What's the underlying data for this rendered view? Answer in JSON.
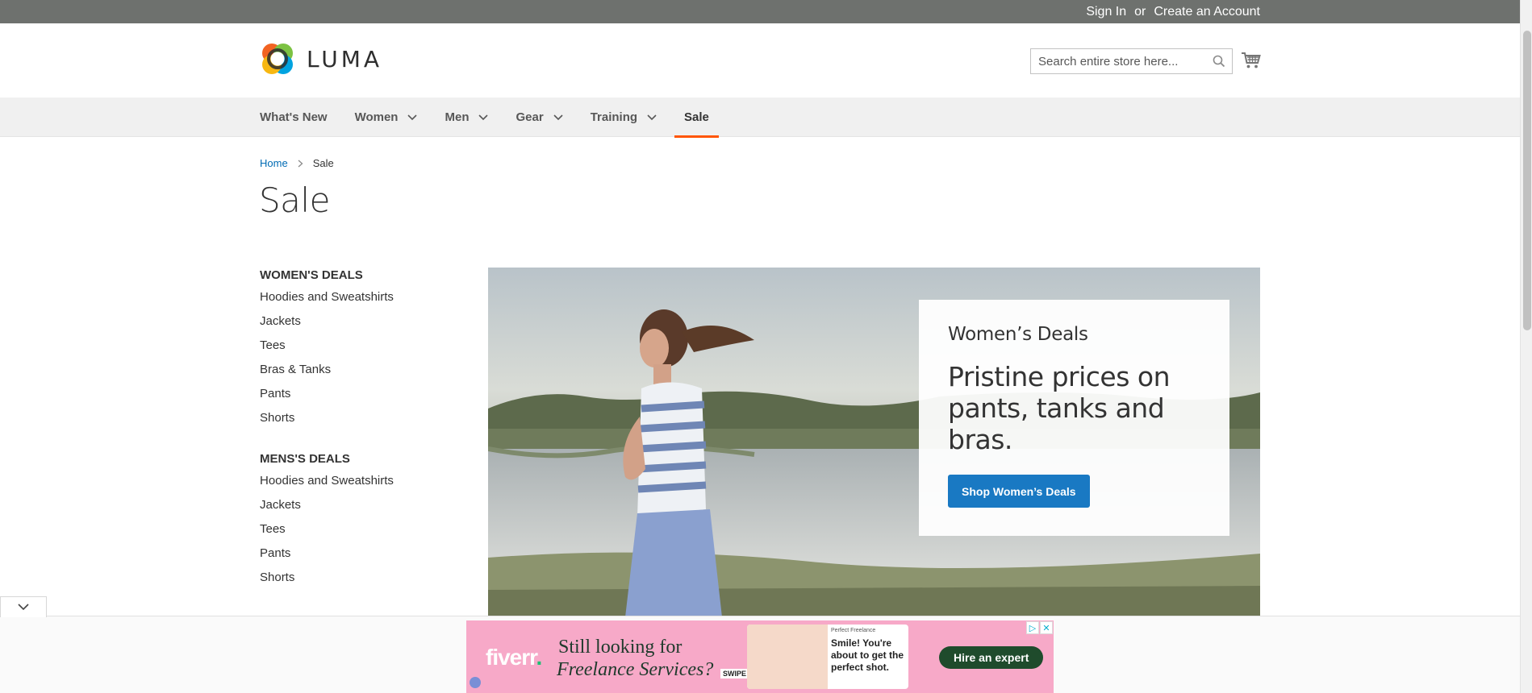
{
  "topbar": {
    "sign_in": "Sign In",
    "or": "or",
    "create_account": "Create an Account"
  },
  "header": {
    "logo_text": "LUMA",
    "search_placeholder": "Search entire store here...",
    "icons": {
      "search": "search-icon",
      "cart": "cart-icon"
    }
  },
  "nav": {
    "items": [
      {
        "label": "What's New",
        "has_submenu": false
      },
      {
        "label": "Women",
        "has_submenu": true
      },
      {
        "label": "Men",
        "has_submenu": true
      },
      {
        "label": "Gear",
        "has_submenu": true
      },
      {
        "label": "Training",
        "has_submenu": true
      },
      {
        "label": "Sale",
        "has_submenu": false,
        "active": true
      }
    ],
    "active_color": "#ff5501"
  },
  "breadcrumb": {
    "home": "Home",
    "current": "Sale"
  },
  "page_title": "Sale",
  "sidebar": {
    "womens": {
      "title": "WOMEN'S DEALS",
      "items": [
        "Hoodies and Sweatshirts",
        "Jackets",
        "Tees",
        "Bras & Tanks",
        "Pants",
        "Shorts"
      ]
    },
    "mens": {
      "title": "MENS'S DEALS",
      "items": [
        "Hoodies and Sweatshirts",
        "Jackets",
        "Tees",
        "Pants",
        "Shorts"
      ]
    }
  },
  "hero": {
    "kicker": "Women’s Deals",
    "headline": "Pristine prices on pants, tanks and bras.",
    "button": "Shop Women’s Deals",
    "button_color": "#1979c3"
  },
  "ad": {
    "brand": "fiverr",
    "tagline_line1": "Still looking for",
    "tagline_line2": "Freelance Services?",
    "card_small": "Perfect Freelance",
    "card_message": "Smile! You're about to get the perfect shot.",
    "swipe": "SWIPE",
    "cta": "Hire an expert"
  }
}
